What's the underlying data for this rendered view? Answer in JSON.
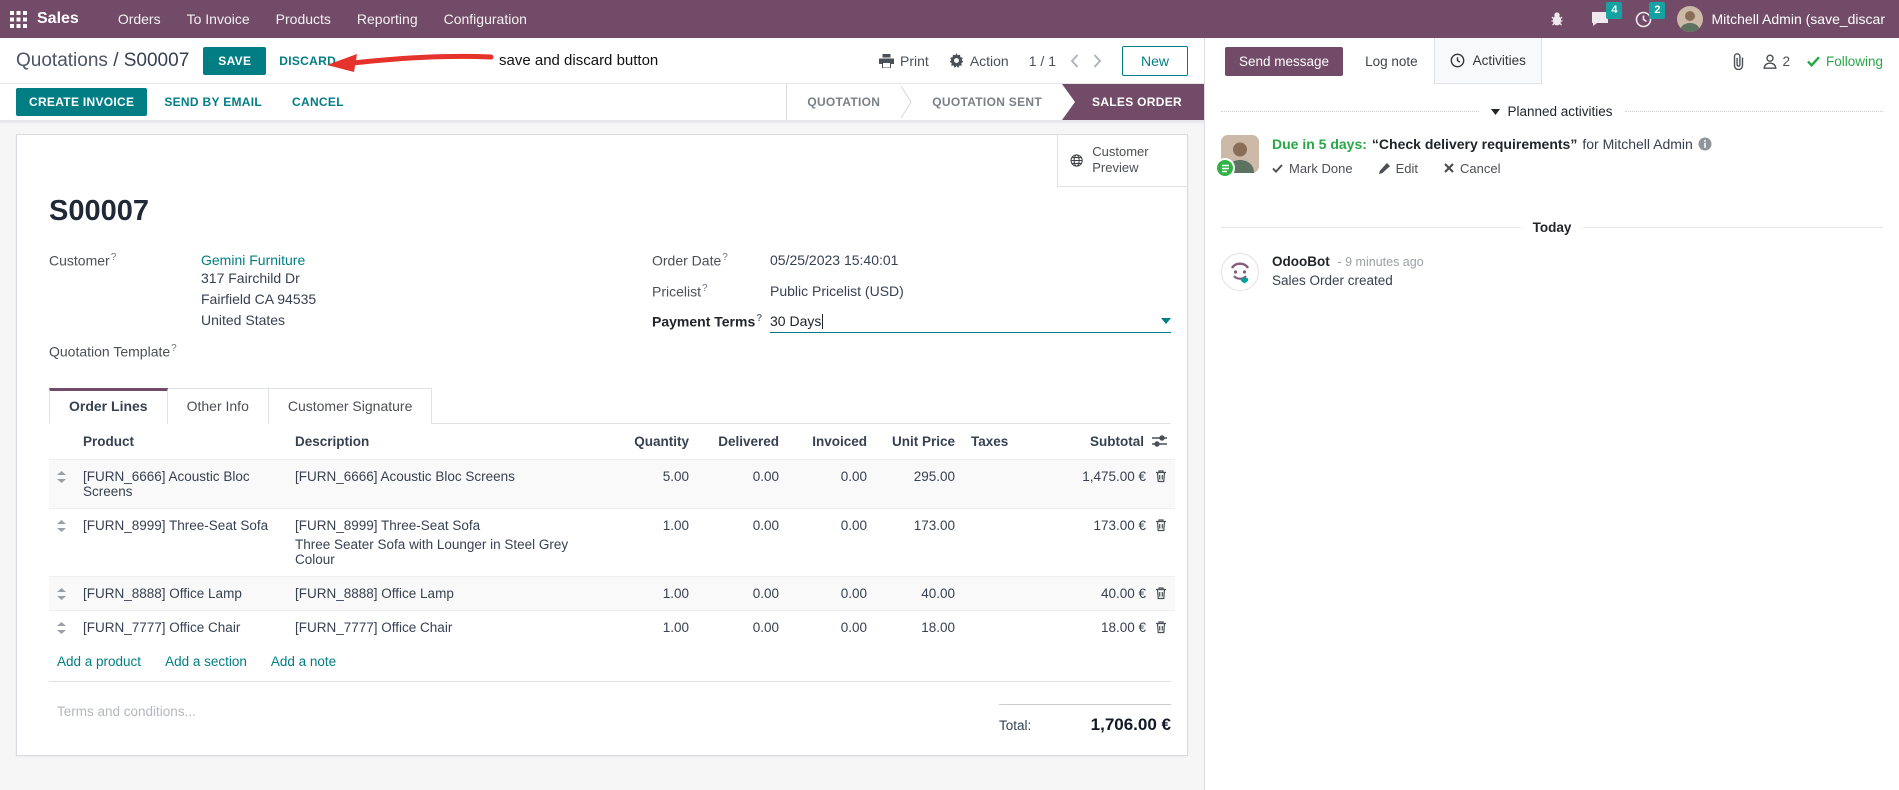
{
  "colors": {
    "brand_purple": "#714B67",
    "accent_teal": "#017E84",
    "badge_teal": "#16A2A0",
    "success_green": "#28a745",
    "annotation_red": "#E5322A"
  },
  "nav": {
    "app_name": "Sales",
    "menus": [
      "Orders",
      "To Invoice",
      "Products",
      "Reporting",
      "Configuration"
    ],
    "messages_badge": "4",
    "activities_badge": "2",
    "user_name": "Mitchell Admin (save_discar"
  },
  "control_panel": {
    "breadcrumb_parent": "Quotations",
    "breadcrumb_sep": "/",
    "breadcrumb_current": "S00007",
    "save_label": "SAVE",
    "discard_label": "DISCARD",
    "annotation_text": "save and discard button",
    "print_label": "Print",
    "action_label": "Action",
    "pager_value": "1 / 1",
    "new_label": "New"
  },
  "status_row": {
    "create_invoice": "CREATE INVOICE",
    "send_by_email": "SEND BY EMAIL",
    "cancel": "CANCEL",
    "states": [
      "QUOTATION",
      "QUOTATION SENT",
      "SALES ORDER"
    ],
    "active_state": "SALES ORDER"
  },
  "form": {
    "customer_preview": "Customer Preview",
    "title": "S00007",
    "help_marker": "?",
    "fields": {
      "customer_label": "Customer",
      "customer_name": "Gemini Furniture",
      "address_line1": "317 Fairchild Dr",
      "address_line2": "Fairfield CA 94535",
      "address_line3": "United States",
      "quotation_template_label": "Quotation Template",
      "order_date_label": "Order Date",
      "order_date_value": "05/25/2023 15:40:01",
      "pricelist_label": "Pricelist",
      "pricelist_value": "Public Pricelist (USD)",
      "payment_terms_label": "Payment Terms",
      "payment_terms_value": "30 Days"
    },
    "tabs": [
      "Order Lines",
      "Other Info",
      "Customer Signature"
    ],
    "table": {
      "headers": {
        "product": "Product",
        "description": "Description",
        "quantity": "Quantity",
        "delivered": "Delivered",
        "invoiced": "Invoiced",
        "unit_price": "Unit Price",
        "taxes": "Taxes",
        "subtotal": "Subtotal"
      },
      "rows": [
        {
          "product": "[FURN_6666] Acoustic Bloc Screens",
          "description": "[FURN_6666] Acoustic Bloc Screens",
          "description2": "",
          "quantity": "5.00",
          "delivered": "0.00",
          "invoiced": "0.00",
          "unit_price": "295.00",
          "taxes": "",
          "subtotal": "1,475.00 €"
        },
        {
          "product": "[FURN_8999] Three-Seat Sofa",
          "description": "[FURN_8999] Three-Seat Sofa",
          "description2": "Three Seater Sofa with Lounger in Steel Grey Colour",
          "quantity": "1.00",
          "delivered": "0.00",
          "invoiced": "0.00",
          "unit_price": "173.00",
          "taxes": "",
          "subtotal": "173.00 €"
        },
        {
          "product": "[FURN_8888] Office Lamp",
          "description": "[FURN_8888] Office Lamp",
          "description2": "",
          "quantity": "1.00",
          "delivered": "0.00",
          "invoiced": "0.00",
          "unit_price": "40.00",
          "taxes": "",
          "subtotal": "40.00 €"
        },
        {
          "product": "[FURN_7777] Office Chair",
          "description": "[FURN_7777] Office Chair",
          "description2": "",
          "quantity": "1.00",
          "delivered": "0.00",
          "invoiced": "0.00",
          "unit_price": "18.00",
          "taxes": "",
          "subtotal": "18.00 €"
        }
      ],
      "add_links": [
        "Add a product",
        "Add a section",
        "Add a note"
      ]
    },
    "terms_placeholder": "Terms and conditions...",
    "total_label": "Total:",
    "total_value": "1,706.00 €"
  },
  "chatter": {
    "send_message": "Send message",
    "log_note": "Log note",
    "activities": "Activities",
    "follower_count": "2",
    "following": "Following",
    "planned_activities_label": "Planned activities",
    "activity": {
      "due": "Due in 5 days:",
      "summary": "“Check delivery requirements”",
      "for_text": "for Mitchell Admin",
      "mark_done": "Mark Done",
      "edit": "Edit",
      "cancel": "Cancel"
    },
    "today_label": "Today",
    "message": {
      "author": "OdooBot",
      "time": "- 9 minutes ago",
      "body": "Sales Order created"
    }
  }
}
